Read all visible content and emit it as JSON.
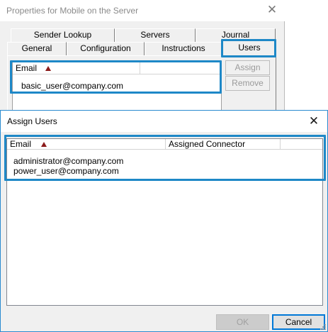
{
  "properties_dialog": {
    "title": "Properties for Mobile on the Server",
    "close_glyph": "✕",
    "tabs_back_row": [
      "Sender Lookup",
      "Servers",
      "Journal"
    ],
    "tabs_front_row": [
      "General",
      "Configuration",
      "Instructions",
      "Users"
    ],
    "active_tab": "Users",
    "list": {
      "column_email": "Email",
      "rows": [
        "basic_user@company.com"
      ]
    },
    "buttons": {
      "assign": "Assign",
      "remove": "Remove"
    }
  },
  "assign_dialog": {
    "title": "Assign Users",
    "close_glyph": "✕",
    "columns": {
      "email": "Email",
      "assigned_connector": "Assigned Connector"
    },
    "rows": [
      {
        "email": "administrator@company.com",
        "connector": ""
      },
      {
        "email": "power_user@company.com",
        "connector": ""
      }
    ],
    "buttons": {
      "ok": "OK",
      "cancel": "Cancel"
    }
  },
  "colors": {
    "highlight": "#1e88c7",
    "sort_arrow": "#8b1a1a",
    "dialog_bg": "#f0f0f0"
  }
}
